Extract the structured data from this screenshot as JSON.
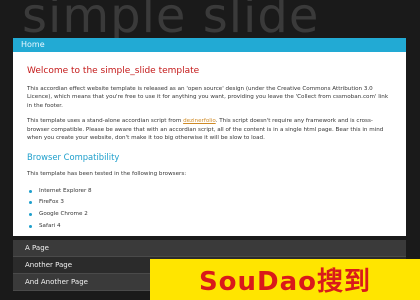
{
  "site": {
    "title": "simple slide"
  },
  "home_tab": {
    "label": "Home"
  },
  "content": {
    "heading": "Welcome to the simple_slide template",
    "paragraph1": "This accordian effect website template is released as an 'open source' design (under the Creative Commons Attribution 3.0 Licence), which means that you're free to use it for anything you want, providing you leave the 'Collect from cssmoban.com' link in the footer.",
    "paragraph2_before_link": "This template uses a stand-alone accordian script from ",
    "paragraph2_link": "dezinerfolio",
    "paragraph2_after_link": ". This script doesn't require any framework and is cross-browser compatible. Please be aware that with an accordian script, all of the content is in a single html page. Bear this in mind when you create your website, don't make it too big otherwise it will be slow to load.",
    "subheading": "Browser Compatibility",
    "paragraph3": "This template has been tested in the following browsers:",
    "browsers": [
      "Internet Explorer 8",
      "FireFox 3",
      "Google Chrome 2",
      "Safari 4"
    ]
  },
  "page_tabs": [
    "A Page",
    "Another Page",
    "And Another Page"
  ],
  "watermark": {
    "text": "SouDao搜到"
  },
  "colors": {
    "accent": "#22aad4",
    "heading_red": "#c41a1a",
    "link": "#cf8a26",
    "background": "#1a1a1a",
    "watermark_bg": "#ffe500",
    "watermark_text": "#d91a1a"
  }
}
